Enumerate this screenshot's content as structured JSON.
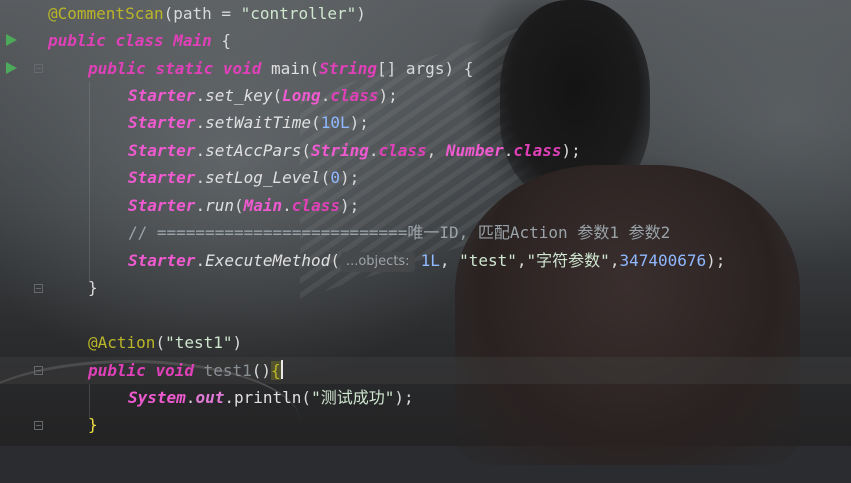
{
  "editor": {
    "lines": [
      {
        "annotation": "@CommentScan",
        "open": "(path = ",
        "string": "\"controller\"",
        "close": ")"
      },
      {
        "kw1": "public",
        "kw2": "class",
        "name": "Main",
        "rest": " {"
      },
      {
        "kw1": "public",
        "kw2": "static",
        "kw3": "void",
        "name": "main",
        "p_open": "(",
        "type": "String",
        "rest": "[] args) {"
      },
      {
        "cls": "Starter",
        "dot": ".",
        "method": "set_key",
        "open": "(",
        "arg": "Long",
        "dot2": ".",
        "kw": "class",
        "close": ");"
      },
      {
        "cls": "Starter",
        "dot": ".",
        "method": "setWaitTime",
        "open": "(",
        "num": "10L",
        "close": ");"
      },
      {
        "cls": "Starter",
        "dot": ".",
        "method": "setAccPars",
        "open": "(",
        "arg1": "String",
        "dot2": ".",
        "kw1": "class",
        "comma": ", ",
        "arg2": "Number",
        "dot3": ".",
        "kw2": "class",
        "close": ");"
      },
      {
        "cls": "Starter",
        "dot": ".",
        "method": "setLog_Level",
        "open": "(",
        "num": "0",
        "close": ");"
      },
      {
        "cls": "Starter",
        "dot": ".",
        "method": "run",
        "open": "(",
        "arg": "Main",
        "dot2": ".",
        "kw": "class",
        "close": ");"
      },
      {
        "comment": "// ==========================唯一ID, 匹配Action 参数1 参数2"
      },
      {
        "cls": "Starter",
        "dot": ".",
        "method": "ExecuteMethod",
        "open": "(",
        "hint": "...objects:",
        "num1": "1L",
        "comma1": ", ",
        "str1": "\"test\"",
        "comma2": ",",
        "str2": "\"字符参数\"",
        "comma3": ",",
        "num2": "347400676",
        "close": ");"
      },
      {
        "text": "}"
      },
      {
        "text": ""
      },
      {
        "annotation": "@Action",
        "open": "(",
        "string": "\"test1\"",
        "close": ")"
      },
      {
        "kw1": "public",
        "kw2": "void",
        "name": "test1",
        "parens": "()",
        "brace": "{"
      },
      {
        "cls": "System",
        "dot": ".",
        "field": "out",
        "dot2": ".",
        "method": "println",
        "open": "(",
        "string": "\"测试成功\"",
        "close": ");"
      },
      {
        "text": "}"
      }
    ]
  },
  "colors": {
    "keyword": "#e040b8",
    "annotation": "#bbb529",
    "string": "#cfe6cf",
    "number": "#8fb8ff",
    "run_gutter": "#4caa5a"
  },
  "icons": [
    "run-icon",
    "fold-icon"
  ]
}
